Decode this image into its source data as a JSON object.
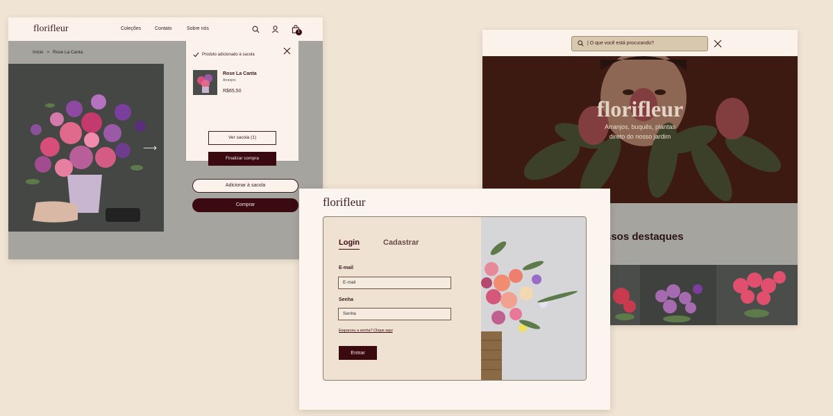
{
  "product_page": {
    "logo": "florifleur",
    "nav": [
      "Coleções",
      "Contato",
      "Sobre nós"
    ],
    "cart_count": "1",
    "breadcrumb": {
      "home": "Início",
      "separator": ">",
      "current": "Rose La Canta"
    },
    "popup": {
      "message": "Produto adicionado à sacola",
      "product_name": "Rose La Canta",
      "product_category": "Arranjos",
      "price": "R$65,50",
      "view_bag": "Ver sacola (1)",
      "checkout": "Finalizar compra"
    },
    "add_to_bag": "Adicionar à sacola",
    "buy": "Comprar"
  },
  "login_page": {
    "logo": "florifleur",
    "tab_login": "Login",
    "tab_register": "Cadastrar",
    "email_label": "E-mail",
    "email_placeholder": "E-mail",
    "password_label": "Senha",
    "password_placeholder": "Senha",
    "forgot": "Esqueceu a senha? Clique aqui",
    "submit": "Entrar"
  },
  "home_page": {
    "search_placeholder": "| O que você está procurando?",
    "hero_title": "florifleur",
    "hero_subtitle_1": "Arranjos, buquês, plantas",
    "hero_subtitle_2": "direto do nosso jardim",
    "section_title": "ssos destaques"
  },
  "colors": {
    "background": "#F0E4D4",
    "accent_dark": "#3A0A10",
    "cream": "#FBF2EC",
    "grey_overlay": "#A6A49F"
  },
  "icons": [
    "search-icon",
    "user-icon",
    "bag-icon",
    "close-icon",
    "check-icon",
    "arrow-right-icon"
  ]
}
